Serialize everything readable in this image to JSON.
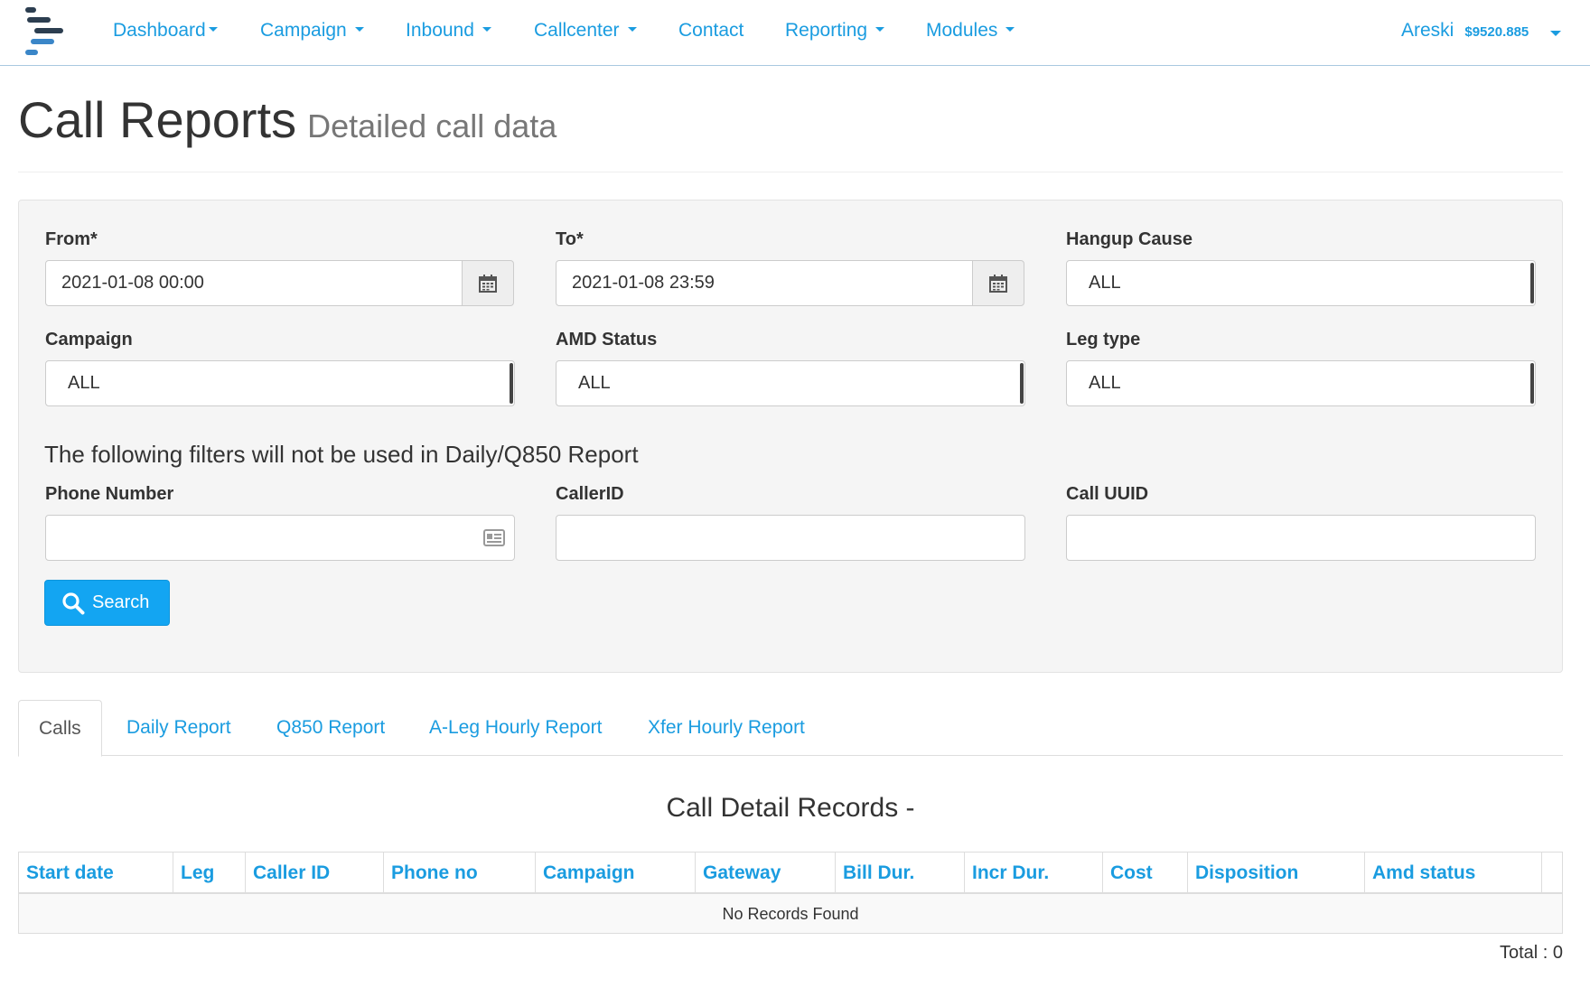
{
  "colors": {
    "accent": "#1a9ce0",
    "button": "#13a5f2",
    "panel_bg": "#f5f5f5"
  },
  "nav": {
    "items": [
      {
        "label": "Dashboard",
        "dropdown": true
      },
      {
        "label": "Campaign",
        "dropdown": true
      },
      {
        "label": "Inbound",
        "dropdown": true
      },
      {
        "label": "Callcenter",
        "dropdown": true
      },
      {
        "label": "Contact",
        "dropdown": false
      },
      {
        "label": "Reporting",
        "dropdown": true
      },
      {
        "label": "Modules",
        "dropdown": true
      }
    ],
    "user": "Areski",
    "balance": "$9520.885"
  },
  "page": {
    "title": "Call Reports",
    "subtitle": "Detailed call data"
  },
  "filters": {
    "from": {
      "label": "From*",
      "value": "2021-01-08 00:00",
      "icon": "calendar-icon"
    },
    "to": {
      "label": "To*",
      "value": "2021-01-08 23:59",
      "icon": "calendar-icon"
    },
    "hangup_cause": {
      "label": "Hangup Cause",
      "value": "ALL"
    },
    "campaign": {
      "label": "Campaign",
      "value": "ALL"
    },
    "amd_status": {
      "label": "AMD Status",
      "value": "ALL"
    },
    "leg_type": {
      "label": "Leg type",
      "value": "ALL"
    },
    "note": "The following filters will not be used in Daily/Q850 Report",
    "phone_number": {
      "label": "Phone Number",
      "value": "",
      "icon": "contact-card-icon"
    },
    "caller_id": {
      "label": "CallerID",
      "value": ""
    },
    "call_uuid": {
      "label": "Call UUID",
      "value": ""
    },
    "search_label": "Search"
  },
  "tabs": [
    {
      "label": "Calls",
      "active": true
    },
    {
      "label": "Daily Report",
      "active": false
    },
    {
      "label": "Q850 Report",
      "active": false
    },
    {
      "label": "A-Leg Hourly Report",
      "active": false
    },
    {
      "label": "Xfer Hourly Report",
      "active": false
    }
  ],
  "table": {
    "title": "Call Detail Records -",
    "columns": [
      "Start date",
      "Leg",
      "Caller ID",
      "Phone no",
      "Campaign",
      "Gateway",
      "Bill Dur.",
      "Incr Dur.",
      "Cost",
      "Disposition",
      "Amd status"
    ],
    "empty_text": "No Records Found",
    "total": "Total : 0"
  }
}
